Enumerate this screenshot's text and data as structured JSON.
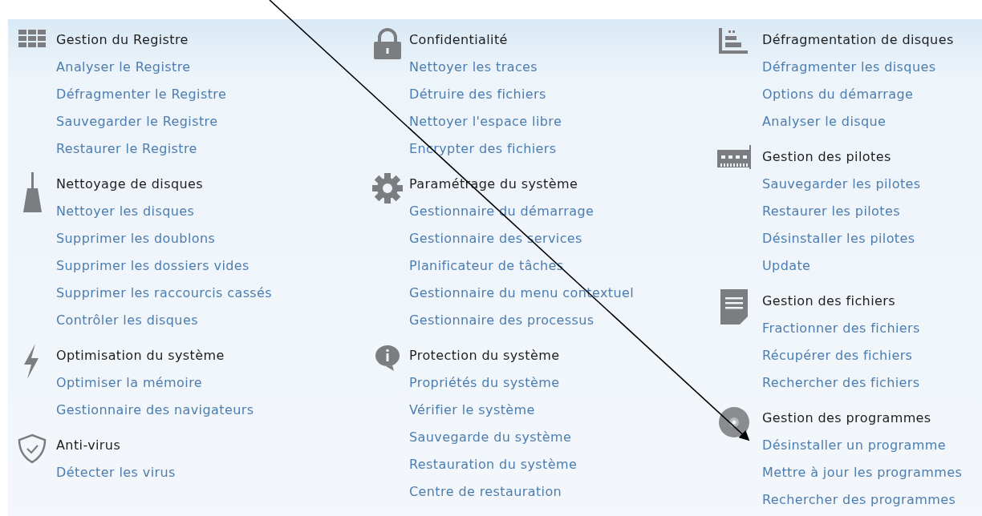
{
  "columns": [
    {
      "groups": [
        {
          "title": "Gestion du Registre",
          "links": [
            "Analyser le Registre",
            "Défragmenter le Registre",
            "Sauvegarder le Registre",
            "Restaurer le Registre"
          ]
        },
        {
          "title": "Nettoyage de disques",
          "links": [
            "Nettoyer les disques",
            "Supprimer les doublons",
            "Supprimer les dossiers vides",
            "Supprimer les raccourcis cassés",
            "Contrôler les disques"
          ]
        },
        {
          "title": "Optimisation du système",
          "links": [
            "Optimiser la mémoire",
            "Gestionnaire des navigateurs"
          ]
        },
        {
          "title": "Anti-virus",
          "links": [
            "Détecter les virus"
          ]
        }
      ]
    },
    {
      "groups": [
        {
          "title": "Confidentialité",
          "links": [
            "Nettoyer les traces",
            "Détruire des fichiers",
            "Nettoyer l'espace libre",
            "Encrypter des fichiers"
          ]
        },
        {
          "title": "Paramétrage du système",
          "links": [
            "Gestionnaire du démarrage",
            "Gestionnaire des services",
            "Planificateur de tâches",
            "Gestionnaire du menu contextuel",
            "Gestionnaire des processus"
          ]
        },
        {
          "title": "Protection du système",
          "links": [
            "Propriétés du système",
            "Vérifier le système",
            "Sauvegarde du système",
            "Restauration du système",
            "Centre de restauration"
          ]
        }
      ]
    },
    {
      "groups": [
        {
          "title": "Défragmentation de disques",
          "links": [
            "Défragmenter les disques",
            "Options du démarrage",
            "Analyser le disque"
          ]
        },
        {
          "title": "Gestion des pilotes",
          "links": [
            "Sauvegarder les pilotes",
            "Restaurer les pilotes",
            "Désinstaller les pilotes",
            "Update"
          ]
        },
        {
          "title": "Gestion des fichiers",
          "links": [
            "Fractionner des fichiers",
            "Récupérer des fichiers",
            "Rechercher des fichiers"
          ]
        },
        {
          "title": "Gestion des programmes",
          "links": [
            "Désinstaller un programme",
            "Mettre à jour les programmes",
            "Rechercher des programmes"
          ]
        }
      ]
    }
  ]
}
